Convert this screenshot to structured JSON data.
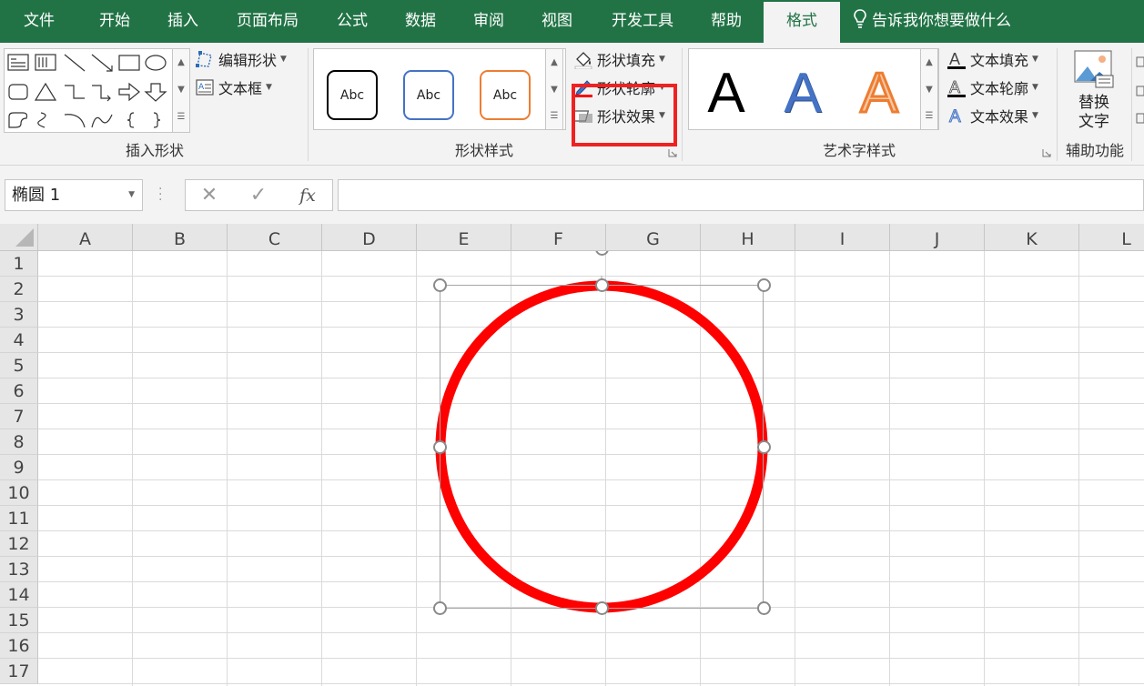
{
  "tabs": [
    {
      "label": "文件"
    },
    {
      "label": "开始"
    },
    {
      "label": "插入"
    },
    {
      "label": "页面布局"
    },
    {
      "label": "公式"
    },
    {
      "label": "数据"
    },
    {
      "label": "审阅"
    },
    {
      "label": "视图"
    },
    {
      "label": "开发工具"
    },
    {
      "label": "帮助"
    },
    {
      "label": "格式",
      "active": true
    }
  ],
  "tell_me": "告诉我你想要做什么",
  "colors": {
    "ribbon_green": "#217346",
    "outline_red": "#ff0000",
    "highlight_red": "#ee2222",
    "wordart_blue": "#4472c4",
    "wordart_orange": "#ed7d31"
  },
  "groups": {
    "insert_shapes": {
      "label": "插入形状",
      "edit_shape": "编辑形状",
      "text_box": "文本框"
    },
    "shape_styles": {
      "label": "形状样式",
      "presets": [
        "Abc",
        "Abc",
        "Abc"
      ],
      "shape_fill": "形状填充",
      "shape_outline": "形状轮廓",
      "shape_effects": "形状效果"
    },
    "wordart_styles": {
      "label": "艺术字样式",
      "presets": [
        "A",
        "A",
        "A"
      ],
      "text_fill": "文本填充",
      "text_outline": "文本轮廓",
      "text_effects": "文本效果"
    },
    "accessibility": {
      "label": "辅助功能",
      "alt_text_line1": "替换",
      "alt_text_line2": "文字"
    }
  },
  "formula_bar": {
    "name_box": "椭圆 1",
    "fx": "fx",
    "formula": ""
  },
  "columns": [
    "A",
    "B",
    "C",
    "D",
    "E",
    "F",
    "G",
    "H",
    "I",
    "J",
    "K",
    "L"
  ],
  "rows": [
    "1",
    "2",
    "3",
    "4",
    "5",
    "6",
    "7",
    "8",
    "9",
    "10",
    "11",
    "12",
    "13",
    "14",
    "15",
    "16",
    "17"
  ],
  "shape": {
    "name": "椭圆 1",
    "fill": "none",
    "outline_color": "#ff0000"
  }
}
